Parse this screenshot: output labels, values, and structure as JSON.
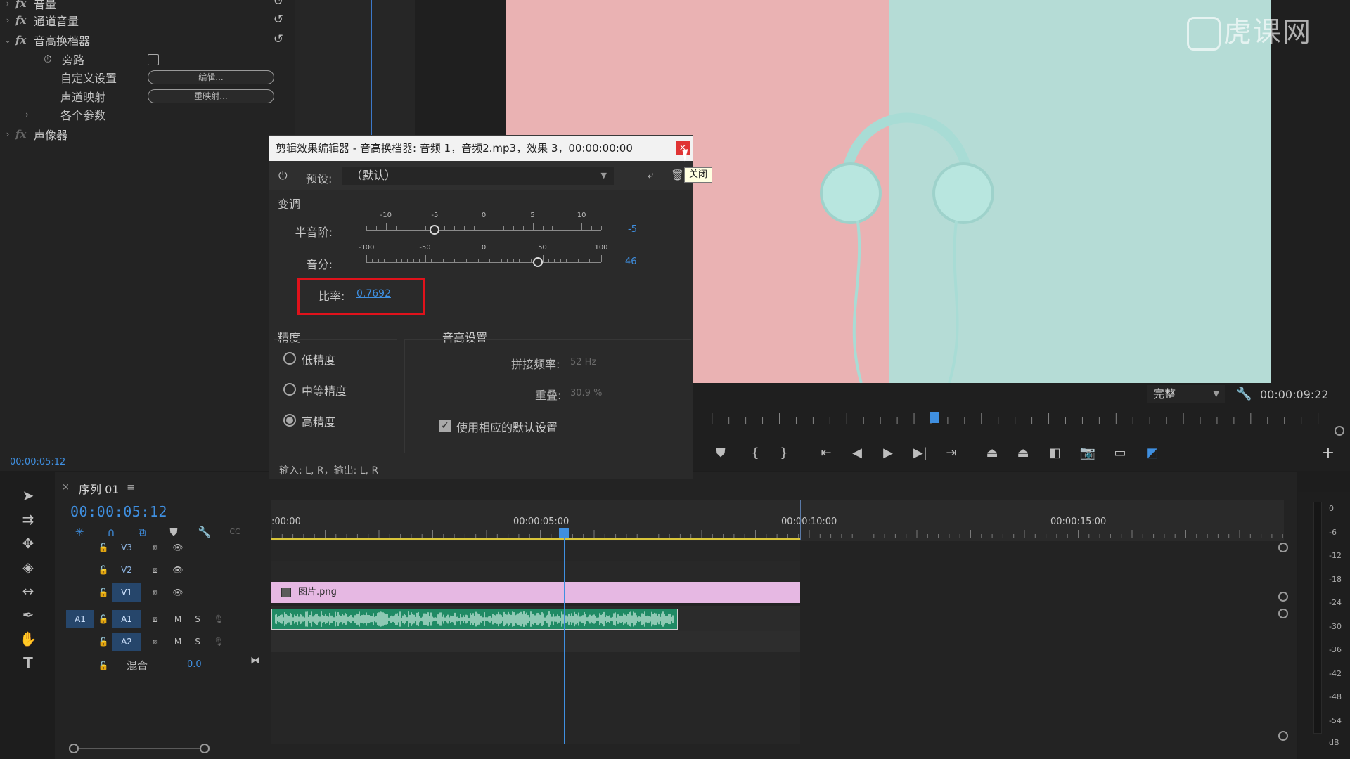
{
  "effects_panel": {
    "rows": [
      {
        "label": "音量",
        "twirl": "›"
      },
      {
        "label": "通道音量",
        "twirl": "›"
      },
      {
        "label": "音高换档器",
        "twirl": "⌄"
      }
    ],
    "pitch_shifter_children": {
      "bypass_label": "旁路",
      "custom_setup_label": "自定义设置",
      "custom_setup_button": "编辑...",
      "channel_map_label": "声道映射",
      "channel_map_button": "重映射...",
      "params_label": "各个参数"
    },
    "panner_label": "声像器",
    "timecode": "00:00:05:12"
  },
  "program_monitor": {
    "fit_select": "完整",
    "duration": "00:00:09:22"
  },
  "dialog": {
    "title": "剪辑效果编辑器 - 音高换档器: 音频 1，音频2.mp3，效果 3，00:00:00:00",
    "close_tooltip": "关闭",
    "preset_label": "预设:",
    "preset_value": "（默认）",
    "section_transpose": "变调",
    "semitones_label": "半音阶:",
    "semitones_ticks": [
      "-10",
      "-5",
      "0",
      "5",
      "10"
    ],
    "semitones_value": "-5",
    "semitones_min": -12,
    "semitones_max": 12,
    "cents_label": "音分:",
    "cents_ticks": [
      "-100",
      "-50",
      "0",
      "50",
      "100"
    ],
    "cents_value": "46",
    "cents_min": -100,
    "cents_max": 100,
    "ratio_label": "比率:",
    "ratio_value": "0.7692",
    "section_precision": "精度",
    "precision_options": [
      {
        "label": "低精度",
        "selected": false
      },
      {
        "label": "中等精度",
        "selected": false
      },
      {
        "label": "高精度",
        "selected": true
      }
    ],
    "section_pitch_settings": "音高设置",
    "splice_freq_label": "拼接频率:",
    "splice_freq_value": "52 Hz",
    "overlap_label": "重叠:",
    "overlap_value": "30.9 %",
    "use_defaults_label": "使用相应的默认设置",
    "io_text": "输入: L, R，输出: L, R"
  },
  "timeline": {
    "sequence_tab": "序列 01",
    "timecode": "00:00:05:12",
    "ruler_labels": [
      ":00:00",
      "00:00:05:00",
      "00:00:10:00",
      "00:00:15:00"
    ],
    "tracks": [
      {
        "name": "V3"
      },
      {
        "name": "V2"
      },
      {
        "name": "V1",
        "targeted": true
      },
      {
        "name": "A1",
        "source": "A1",
        "targeted": true
      },
      {
        "name": "A2"
      }
    ],
    "mute_label": "M",
    "solo_label": "S",
    "image_clip_label": "图片.png",
    "mix_label": "混合",
    "mix_value": "0.0"
  },
  "meters": {
    "db_labels": [
      "0",
      "-6",
      "-12",
      "-18",
      "-24",
      "-30",
      "-36",
      "-42",
      "-48",
      "-54",
      "dB"
    ]
  },
  "watermark_text": "虎课网",
  "colors": {
    "accent_blue": "#3f8fe0",
    "highlight_red": "#e0121b",
    "image_clip": "#e6b8e3",
    "audio_clip": "#1f8a64"
  }
}
